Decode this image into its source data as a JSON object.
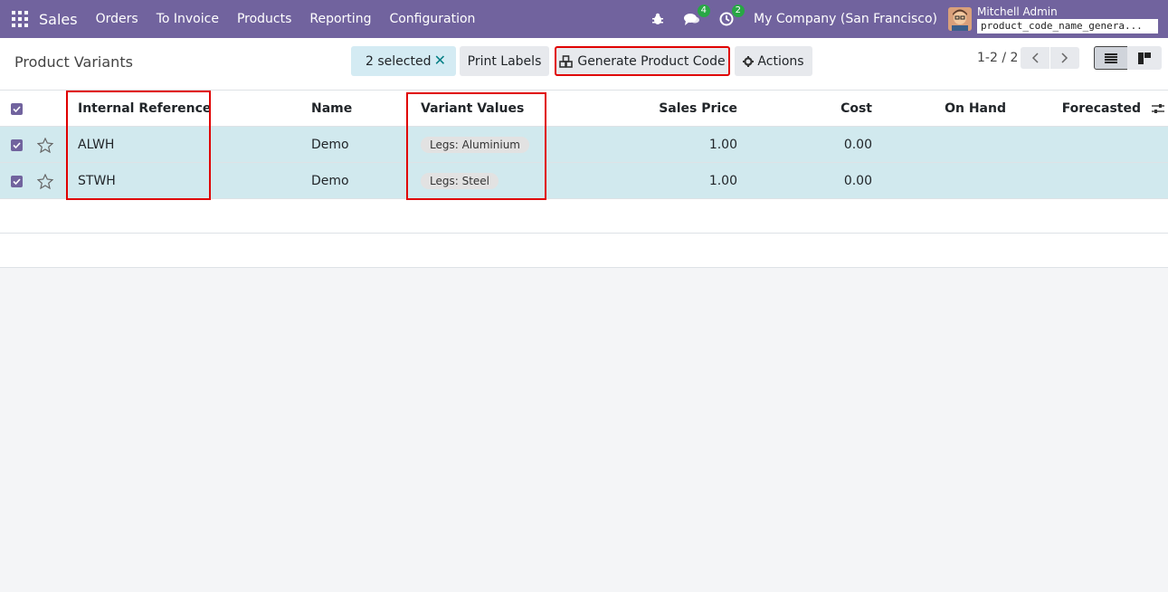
{
  "navbar": {
    "brand": "Sales",
    "menu": [
      "Orders",
      "To Invoice",
      "Products",
      "Reporting",
      "Configuration"
    ],
    "messages_count": "4",
    "activities_count": "2",
    "company": "My Company (San Francisco)",
    "user_name": "Mitchell Admin",
    "db_name": "product_code_name_genera..."
  },
  "control": {
    "breadcrumb": "Product Variants",
    "selected_label": "2 selected",
    "print_labels": "Print Labels",
    "generate_code": "Generate Product Code",
    "actions": "Actions",
    "pager": "1-2 / 2"
  },
  "table": {
    "columns": {
      "internal_reference": "Internal Reference",
      "name": "Name",
      "variant_values": "Variant Values",
      "sales_price": "Sales Price",
      "cost": "Cost",
      "on_hand": "On Hand",
      "forecasted": "Forecasted"
    },
    "rows": [
      {
        "ref": "ALWH",
        "name": "Demo",
        "variant": "Legs: Aluminium",
        "price": "1.00",
        "cost": "0.00"
      },
      {
        "ref": "STWH",
        "name": "Demo",
        "variant": "Legs: Steel",
        "price": "1.00",
        "cost": "0.00"
      }
    ]
  },
  "colors": {
    "navbar": "#71639e",
    "selected_row": "#d1e9ee",
    "highlight": "#e00000"
  }
}
